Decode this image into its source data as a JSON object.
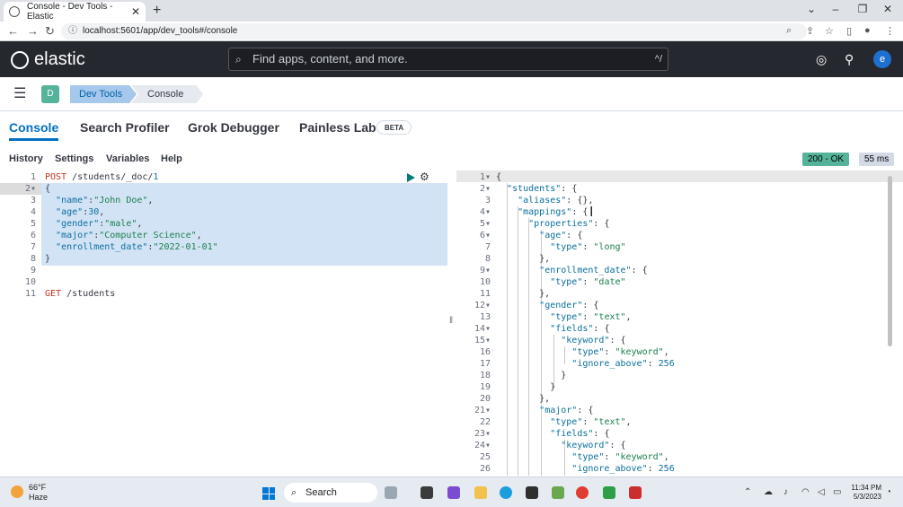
{
  "browser": {
    "tab_title": "Console - Dev Tools - Elastic",
    "new_tab_glyph": "+",
    "url": "localhost:5601/app/dev_tools#/console"
  },
  "header": {
    "brand": "elastic",
    "search_placeholder": "Find apps, content, and more.",
    "search_shortcut": "^/",
    "avatar_letter": "e"
  },
  "breadcrumbs": {
    "space_letter": "D",
    "items": [
      "Dev Tools",
      "Console"
    ]
  },
  "app_tabs": {
    "console": "Console",
    "search_profiler": "Search Profiler",
    "grok_debugger": "Grok Debugger",
    "painless_lab": "Painless Lab",
    "beta_badge": "BETA"
  },
  "menu": {
    "history": "History",
    "settings": "Settings",
    "variables": "Variables",
    "help": "Help"
  },
  "response_status": {
    "status": "200 - OK",
    "time": "55 ms"
  },
  "request_editor": {
    "lines": [
      {
        "n": "1",
        "fold": false,
        "text": "POST /students/_doc/1"
      },
      {
        "n": "2",
        "fold": true,
        "text": "{"
      },
      {
        "n": "3",
        "fold": false,
        "text": "  \"name\":\"John Doe\","
      },
      {
        "n": "4",
        "fold": false,
        "text": "  \"age\":30,"
      },
      {
        "n": "5",
        "fold": false,
        "text": "  \"gender\":\"male\","
      },
      {
        "n": "6",
        "fold": false,
        "text": "  \"major\":\"Computer Science\","
      },
      {
        "n": "7",
        "fold": false,
        "text": "  \"enrollment_date\":\"2022-01-01\""
      },
      {
        "n": "8",
        "fold": false,
        "text": "}"
      },
      {
        "n": "9",
        "fold": false,
        "text": ""
      },
      {
        "n": "10",
        "fold": false,
        "text": ""
      },
      {
        "n": "11",
        "fold": false,
        "text": "GET /students"
      }
    ]
  },
  "response_editor": {
    "lines": [
      {
        "n": "1",
        "fold": true,
        "text": "{"
      },
      {
        "n": "2",
        "fold": true,
        "text": "  \"students\": {"
      },
      {
        "n": "3",
        "fold": false,
        "text": "    \"aliases\": {},"
      },
      {
        "n": "4",
        "fold": true,
        "text": "    \"mappings\": {"
      },
      {
        "n": "5",
        "fold": true,
        "text": "      \"properties\": {"
      },
      {
        "n": "6",
        "fold": true,
        "text": "        \"age\": {"
      },
      {
        "n": "7",
        "fold": false,
        "text": "          \"type\": \"long\""
      },
      {
        "n": "8",
        "fold": false,
        "text": "        },"
      },
      {
        "n": "9",
        "fold": true,
        "text": "        \"enrollment_date\": {"
      },
      {
        "n": "10",
        "fold": false,
        "text": "          \"type\": \"date\""
      },
      {
        "n": "11",
        "fold": false,
        "text": "        },"
      },
      {
        "n": "12",
        "fold": true,
        "text": "        \"gender\": {"
      },
      {
        "n": "13",
        "fold": false,
        "text": "          \"type\": \"text\","
      },
      {
        "n": "14",
        "fold": true,
        "text": "          \"fields\": {"
      },
      {
        "n": "15",
        "fold": true,
        "text": "            \"keyword\": {"
      },
      {
        "n": "16",
        "fold": false,
        "text": "              \"type\": \"keyword\","
      },
      {
        "n": "17",
        "fold": false,
        "text": "              \"ignore_above\": 256"
      },
      {
        "n": "18",
        "fold": false,
        "text": "            }"
      },
      {
        "n": "19",
        "fold": false,
        "text": "          }"
      },
      {
        "n": "20",
        "fold": false,
        "text": "        },"
      },
      {
        "n": "21",
        "fold": true,
        "text": "        \"major\": {"
      },
      {
        "n": "22",
        "fold": false,
        "text": "          \"type\": \"text\","
      },
      {
        "n": "23",
        "fold": true,
        "text": "          \"fields\": {"
      },
      {
        "n": "24",
        "fold": true,
        "text": "            \"keyword\": {"
      },
      {
        "n": "25",
        "fold": false,
        "text": "              \"type\": \"keyword\","
      },
      {
        "n": "26",
        "fold": false,
        "text": "              \"ignore_above\": 256"
      }
    ]
  },
  "taskbar": {
    "weather_temp": "66°F",
    "weather_desc": "Haze",
    "search_label": "Search",
    "time": "11:34 PM",
    "date": "5/3/2023"
  },
  "colors": {
    "header_bg": "#25282f",
    "accent": "#0071c2",
    "status_ok": "#54b399",
    "selection": "#d3e3f6",
    "key_color": "#0b6f9d",
    "string_color": "#1a7f4b",
    "method_color": "#c5311d"
  }
}
